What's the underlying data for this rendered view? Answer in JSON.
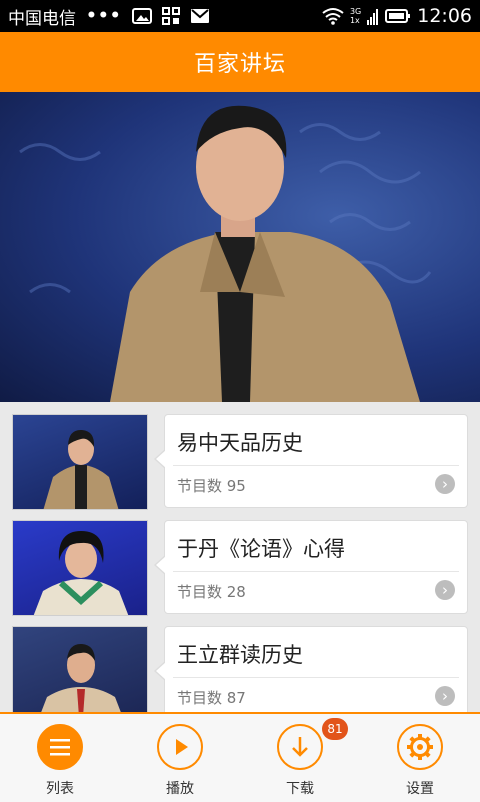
{
  "status_bar": {
    "carrier": "中国电信",
    "dots": "•••",
    "network_top": "3G",
    "network_bottom": "1x",
    "time": "12:06"
  },
  "header": {
    "title": "百家讲坛"
  },
  "colors": {
    "accent": "#ff8a00",
    "badge": "#e2541a"
  },
  "lectures": [
    {
      "title": "易中天品历史",
      "count_label": "节目数 95"
    },
    {
      "title": "于丹《论语》心得",
      "count_label": "节目数 28"
    },
    {
      "title": "王立群读历史",
      "count_label": "节目数 87"
    }
  ],
  "bottom_nav": {
    "items": [
      {
        "label": "列表",
        "icon": "list-icon"
      },
      {
        "label": "播放",
        "icon": "play-icon"
      },
      {
        "label": "下载",
        "icon": "download-icon",
        "badge": "81"
      },
      {
        "label": "设置",
        "icon": "gear-icon"
      }
    ]
  }
}
